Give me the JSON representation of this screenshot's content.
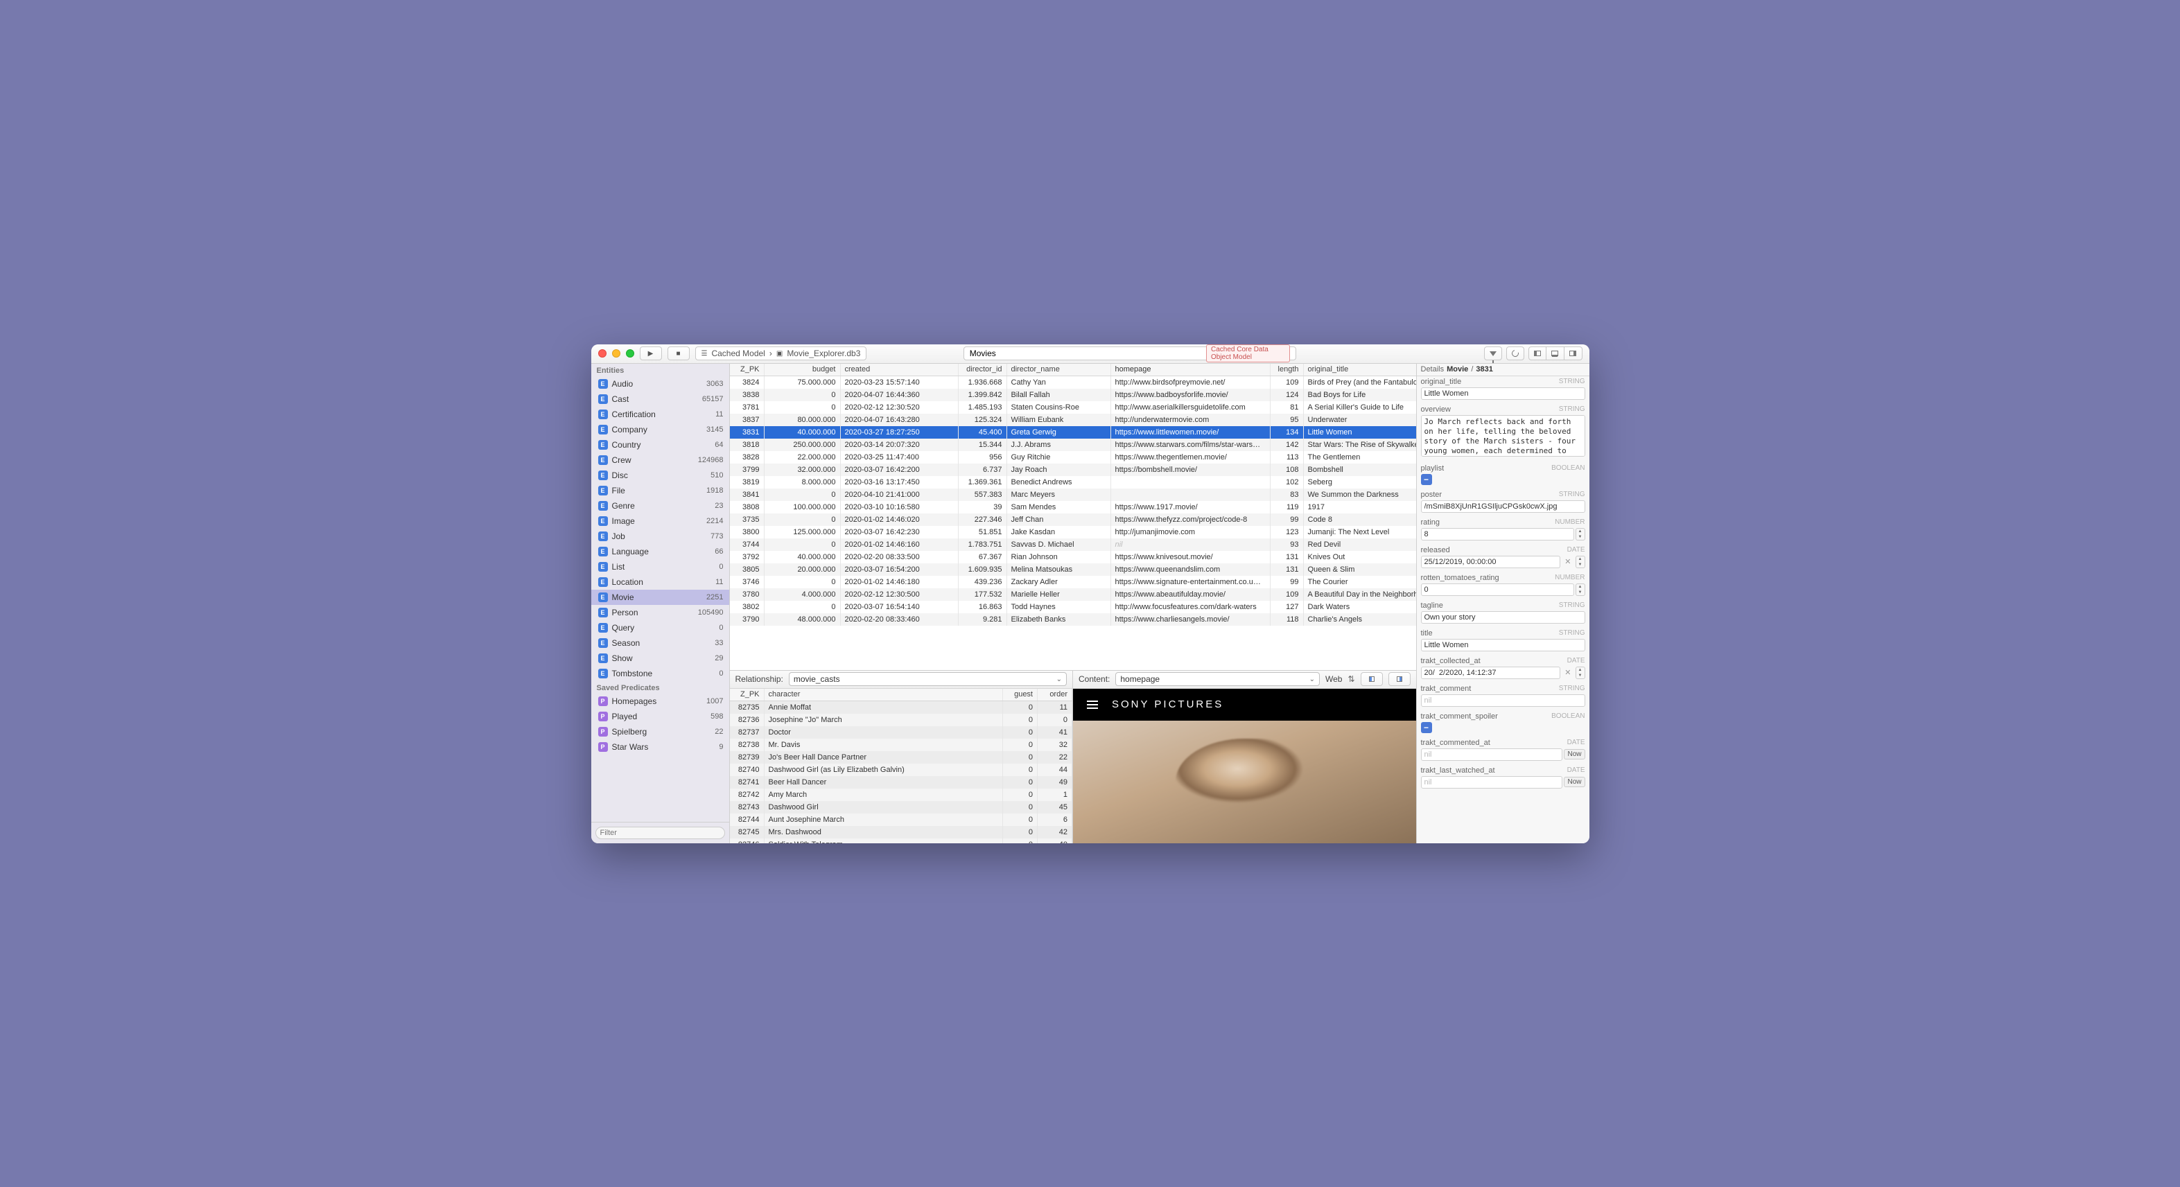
{
  "toolbar": {
    "breadcrumb": [
      "Cached Model",
      "Movie_Explorer.db3"
    ],
    "search_value": "Movies",
    "badge": "Cached Core Data Object Model"
  },
  "sidebar": {
    "entities_label": "Entities",
    "entities": [
      {
        "name": "Audio",
        "count": 3063
      },
      {
        "name": "Cast",
        "count": 65157
      },
      {
        "name": "Certification",
        "count": 11
      },
      {
        "name": "Company",
        "count": 3145
      },
      {
        "name": "Country",
        "count": 64
      },
      {
        "name": "Crew",
        "count": 124968
      },
      {
        "name": "Disc",
        "count": 510
      },
      {
        "name": "File",
        "count": 1918
      },
      {
        "name": "Genre",
        "count": 23
      },
      {
        "name": "Image",
        "count": 2214
      },
      {
        "name": "Job",
        "count": 773
      },
      {
        "name": "Language",
        "count": 66
      },
      {
        "name": "List",
        "count": 0
      },
      {
        "name": "Location",
        "count": 11
      },
      {
        "name": "Movie",
        "count": 2251,
        "selected": true
      },
      {
        "name": "Person",
        "count": 105490
      },
      {
        "name": "Query",
        "count": 0
      },
      {
        "name": "Season",
        "count": 33
      },
      {
        "name": "Show",
        "count": 29
      },
      {
        "name": "Tombstone",
        "count": 0
      }
    ],
    "predicates_label": "Saved Predicates",
    "predicates": [
      {
        "name": "Homepages",
        "count": 1007
      },
      {
        "name": "Played",
        "count": 598
      },
      {
        "name": "Spielberg",
        "count": 22
      },
      {
        "name": "Star Wars",
        "count": 9
      }
    ],
    "filter_placeholder": "Filter"
  },
  "table": {
    "columns": [
      "Z_PK",
      "budget",
      "created",
      "director_id",
      "director_name",
      "homepage",
      "length",
      "original_title"
    ],
    "rows": [
      {
        "pk": 3824,
        "budget": "75.000.000",
        "created": "2020-03-23 15:57:140",
        "did": "1.936.668",
        "dn": "Cathy Yan",
        "hp": "http://www.birdsofpreymovie.net/",
        "len": 109,
        "ot": "Birds of Prey (and the Fantabulous E…"
      },
      {
        "pk": 3838,
        "budget": "0",
        "created": "2020-04-07 16:44:360",
        "did": "1.399.842",
        "dn": "Bilall Fallah",
        "hp": "https://www.badboysforlife.movie/",
        "len": 124,
        "ot": "Bad Boys for Life"
      },
      {
        "pk": 3781,
        "budget": "0",
        "created": "2020-02-12 12:30:520",
        "did": "1.485.193",
        "dn": "Staten Cousins-Roe",
        "hp": "http://www.aserialkillersguidetolife.com",
        "len": 81,
        "ot": "A Serial Killer's Guide to Life"
      },
      {
        "pk": 3837,
        "budget": "80.000.000",
        "created": "2020-04-07 16:43:280",
        "did": "125.324",
        "dn": "William Eubank",
        "hp": "http://underwatermovie.com",
        "len": 95,
        "ot": "Underwater"
      },
      {
        "pk": 3831,
        "budget": "40.000.000",
        "created": "2020-03-27 18:27:250",
        "did": "45.400",
        "dn": "Greta Gerwig",
        "hp": "https://www.littlewomen.movie/",
        "len": 134,
        "ot": "Little Women",
        "selected": true
      },
      {
        "pk": 3818,
        "budget": "250.000.000",
        "created": "2020-03-14 20:07:320",
        "did": "15.344",
        "dn": "J.J. Abrams",
        "hp": "https://www.starwars.com/films/star-wars…",
        "len": 142,
        "ot": "Star Wars: The Rise of Skywalker"
      },
      {
        "pk": 3828,
        "budget": "22.000.000",
        "created": "2020-03-25 11:47:400",
        "did": "956",
        "dn": "Guy Ritchie",
        "hp": "https://www.thegentlemen.movie/",
        "len": 113,
        "ot": "The Gentlemen"
      },
      {
        "pk": 3799,
        "budget": "32.000.000",
        "created": "2020-03-07 16:42:200",
        "did": "6.737",
        "dn": "Jay Roach",
        "hp": "https://bombshell.movie/",
        "len": 108,
        "ot": "Bombshell"
      },
      {
        "pk": 3819,
        "budget": "8.000.000",
        "created": "2020-03-16 13:17:450",
        "did": "1.369.361",
        "dn": "Benedict Andrews",
        "hp": "",
        "len": 102,
        "ot": "Seberg"
      },
      {
        "pk": 3841,
        "budget": "0",
        "created": "2020-04-10 21:41:000",
        "did": "557.383",
        "dn": "Marc Meyers",
        "hp": "",
        "len": 83,
        "ot": "We Summon the Darkness"
      },
      {
        "pk": 3808,
        "budget": "100.000.000",
        "created": "2020-03-10 10:16:580",
        "did": "39",
        "dn": "Sam Mendes",
        "hp": "https://www.1917.movie/",
        "len": 119,
        "ot": "1917"
      },
      {
        "pk": 3735,
        "budget": "0",
        "created": "2020-01-02 14:46:020",
        "did": "227.346",
        "dn": "Jeff Chan",
        "hp": "https://www.thefyzz.com/project/code-8",
        "len": 99,
        "ot": "Code 8"
      },
      {
        "pk": 3800,
        "budget": "125.000.000",
        "created": "2020-03-07 16:42:230",
        "did": "51.851",
        "dn": "Jake Kasdan",
        "hp": "http://jumanjimovie.com",
        "len": 123,
        "ot": "Jumanji: The Next Level"
      },
      {
        "pk": 3744,
        "budget": "0",
        "created": "2020-01-02 14:46:160",
        "did": "1.783.751",
        "dn": "Savvas D. Michael",
        "hp": "nil",
        "len": 93,
        "ot": "Red Devil",
        "nilhp": true
      },
      {
        "pk": 3792,
        "budget": "40.000.000",
        "created": "2020-02-20 08:33:500",
        "did": "67.367",
        "dn": "Rian Johnson",
        "hp": "https://www.knivesout.movie/",
        "len": 131,
        "ot": "Knives Out"
      },
      {
        "pk": 3805,
        "budget": "20.000.000",
        "created": "2020-03-07 16:54:200",
        "did": "1.609.935",
        "dn": "Melina Matsoukas",
        "hp": "https://www.queenandslim.com",
        "len": 131,
        "ot": "Queen & Slim"
      },
      {
        "pk": 3746,
        "budget": "0",
        "created": "2020-01-02 14:46:180",
        "did": "439.236",
        "dn": "Zackary Adler",
        "hp": "https://www.signature-entertainment.co.u…",
        "len": 99,
        "ot": "The Courier"
      },
      {
        "pk": 3780,
        "budget": "4.000.000",
        "created": "2020-02-12 12:30:500",
        "did": "177.532",
        "dn": "Marielle Heller",
        "hp": "https://www.abeautifulday.movie/",
        "len": 109,
        "ot": "A Beautiful Day in the Neighborhood"
      },
      {
        "pk": 3802,
        "budget": "0",
        "created": "2020-03-07 16:54:140",
        "did": "16.863",
        "dn": "Todd Haynes",
        "hp": "http://www.focusfeatures.com/dark-waters",
        "len": 127,
        "ot": "Dark Waters"
      },
      {
        "pk": 3790,
        "budget": "48.000.000",
        "created": "2020-02-20 08:33:460",
        "did": "9.281",
        "dn": "Elizabeth Banks",
        "hp": "https://www.charliesangels.movie/",
        "len": 118,
        "ot": "Charlie's Angels"
      }
    ]
  },
  "relationship": {
    "label": "Relationship:",
    "value": "movie_casts",
    "columns": [
      "Z_PK",
      "character",
      "guest",
      "order"
    ],
    "rows": [
      {
        "pk": 82735,
        "ch": "Annie Moffat",
        "g": 0,
        "o": 11
      },
      {
        "pk": 82736,
        "ch": "Josephine \"Jo\" March",
        "g": 0,
        "o": 0
      },
      {
        "pk": 82737,
        "ch": "Doctor",
        "g": 0,
        "o": 41
      },
      {
        "pk": 82738,
        "ch": "Mr. Davis",
        "g": 0,
        "o": 32
      },
      {
        "pk": 82739,
        "ch": "Jo's Beer Hall Dance Partner",
        "g": 0,
        "o": 22
      },
      {
        "pk": 82740,
        "ch": "Dashwood Girl (as Lily Elizabeth Galvin)",
        "g": 0,
        "o": 44
      },
      {
        "pk": 82741,
        "ch": "Beer Hall Dancer",
        "g": 0,
        "o": 49
      },
      {
        "pk": 82742,
        "ch": "Amy March",
        "g": 0,
        "o": 1
      },
      {
        "pk": 82743,
        "ch": "Dashwood Girl",
        "g": 0,
        "o": 45
      },
      {
        "pk": 82744,
        "ch": "Aunt Josephine March",
        "g": 0,
        "o": 6
      },
      {
        "pk": 82745,
        "ch": "Mrs. Dashwood",
        "g": 0,
        "o": 42
      },
      {
        "pk": 82746,
        "ch": "Soldier With Telegram",
        "g": 0,
        "o": 40
      }
    ]
  },
  "content": {
    "label": "Content:",
    "value": "homepage",
    "web_label": "Web",
    "logo": "SONY PICTURES"
  },
  "details": {
    "title_prefix": "Details",
    "title_entity": "Movie",
    "title_pk": "3831",
    "fields": [
      {
        "key": "original_title",
        "type": "STRING",
        "value": "Little Women",
        "input": "text"
      },
      {
        "key": "overview",
        "type": "STRING",
        "value": "Jo March reflects back and forth on her life, telling the beloved story of the March sisters - four young women, each determined to live life on her own terms.",
        "input": "textarea"
      },
      {
        "key": "playlist",
        "type": "BOOLEAN",
        "value": "-",
        "input": "bool"
      },
      {
        "key": "poster",
        "type": "STRING",
        "value": "/mSmiB8XjUnR1GSIljuCPGsk0cwX.jpg",
        "input": "text"
      },
      {
        "key": "rating",
        "type": "NUMBER",
        "value": "8",
        "input": "number"
      },
      {
        "key": "released",
        "type": "DATE",
        "value": "25/12/2019, 00:00:00",
        "input": "date"
      },
      {
        "key": "rotten_tomatoes_rating",
        "type": "NUMBER",
        "value": "0",
        "input": "number"
      },
      {
        "key": "tagline",
        "type": "STRING",
        "value": "Own your story",
        "input": "text"
      },
      {
        "key": "title",
        "type": "STRING",
        "value": "Little Women",
        "input": "text"
      },
      {
        "key": "trakt_collected_at",
        "type": "DATE",
        "value": "20/  2/2020, 14:12:37",
        "input": "date"
      },
      {
        "key": "trakt_comment",
        "type": "STRING",
        "value": "nil",
        "input": "text",
        "nil": true
      },
      {
        "key": "trakt_comment_spoiler",
        "type": "BOOLEAN",
        "value": "-",
        "input": "bool"
      },
      {
        "key": "trakt_commented_at",
        "type": "DATE",
        "value": "nil",
        "input": "date",
        "nil": true,
        "now": true
      },
      {
        "key": "trakt_last_watched_at",
        "type": "DATE",
        "value": "nil",
        "input": "date",
        "nil": true,
        "now": true
      }
    ]
  }
}
